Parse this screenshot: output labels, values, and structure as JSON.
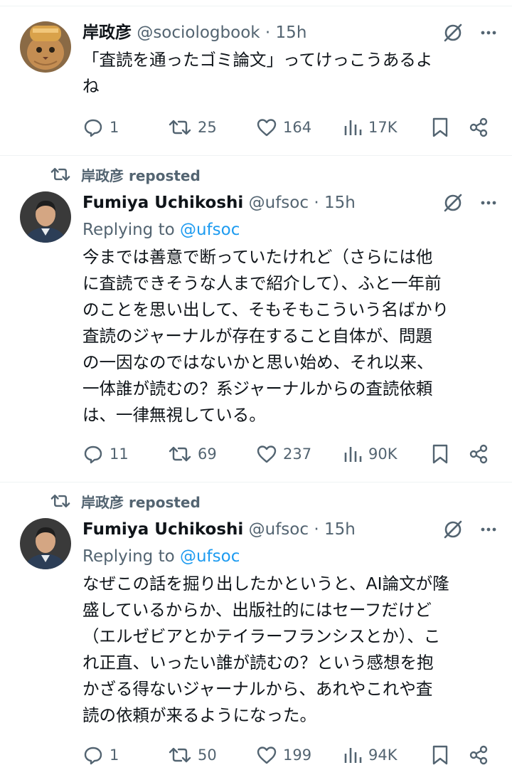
{
  "colors": {
    "text": "#0f1419",
    "secondary": "#536471",
    "link": "#1d9bf0",
    "divider": "#eff3f4"
  },
  "tweets": [
    {
      "reposted_by": null,
      "author_name": "岸政彦",
      "author_handle": "@sociologbook",
      "time": "15h",
      "replying_to_label": null,
      "replying_to_handle": null,
      "text": "「査読を通ったゴミ論文」ってけっこうあるよ\nね",
      "stats": {
        "replies": "1",
        "reposts": "25",
        "likes": "164",
        "views": "17K"
      },
      "icons": [
        "grok-icon",
        "more-icon",
        "reply-icon",
        "repost-icon",
        "like-icon",
        "views-icon",
        "bookmark-icon",
        "share-icon"
      ]
    },
    {
      "reposted_by": "岸政彦 reposted",
      "author_name": "Fumiya Uchikoshi",
      "author_handle": "@ufsoc",
      "time": "15h",
      "replying_to_label": "Replying to",
      "replying_to_handle": "@ufsoc",
      "text": "今までは善意で断っていたけれど（さらには他\nに査読できそうな人まで紹介して）、ふと一年前\nのことを思い出して、そもそもこういう名ばかり\n査読のジャーナルが存在すること自体が、問題\nの一因なのではないかと思い始め、それ以来、\n一体誰が読むの？系ジャーナルからの査読依頼\nは、一律無視している。",
      "stats": {
        "replies": "11",
        "reposts": "69",
        "likes": "237",
        "views": "90K"
      }
    },
    {
      "reposted_by": "岸政彦 reposted",
      "author_name": "Fumiya Uchikoshi",
      "author_handle": "@ufsoc",
      "time": "15h",
      "replying_to_label": "Replying to",
      "replying_to_handle": "@ufsoc",
      "text": "なぜこの話を掘り出したかというと、AI論文が隆\n盛しているからか、出版社的にはセーフだけど\n（エルゼビアとかテイラーフランシスとか）、こ\nれ正直、いったい誰が読むの？という感想を抱\nかざる得ないジャーナルから、あれやこれや査\n読の依頼が来るようになった。",
      "stats": {
        "replies": "1",
        "reposts": "50",
        "likes": "199",
        "views": "94K"
      }
    }
  ]
}
